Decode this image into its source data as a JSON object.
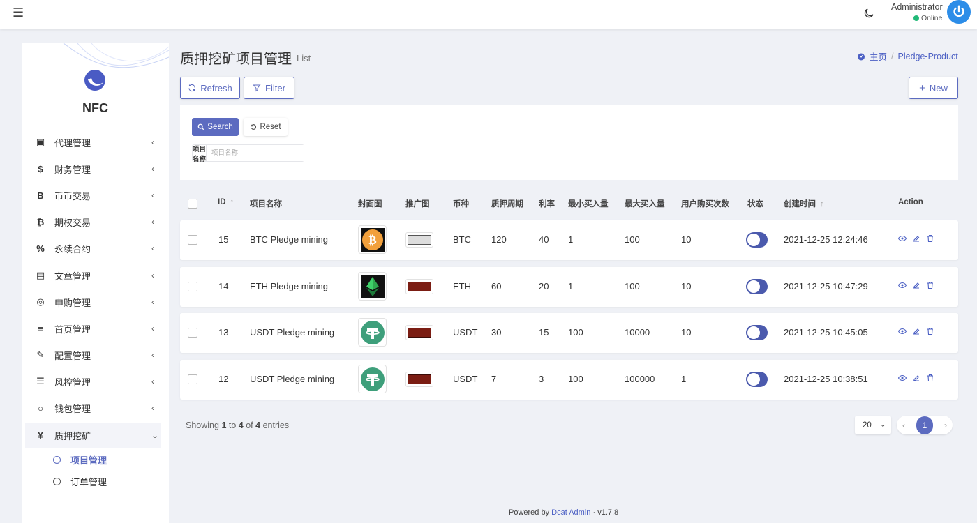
{
  "topbar": {
    "user_name": "Administrator",
    "user_status": "Online",
    "icons": [
      "hamburger-icon",
      "moon-icon",
      "power-avatar"
    ]
  },
  "sidebar": {
    "brand": "NFC",
    "items": [
      {
        "label": "代理管理",
        "icon": "id-card-icon",
        "glyph": "▣"
      },
      {
        "label": "财务管理",
        "icon": "dollar-icon",
        "glyph": "$"
      },
      {
        "label": "币币交易",
        "icon": "b-icon",
        "glyph": "B"
      },
      {
        "label": "期权交易",
        "icon": "bitcoin-icon",
        "glyph": "₿"
      },
      {
        "label": "永续合约",
        "icon": "link-icon",
        "glyph": "%"
      },
      {
        "label": "文章管理",
        "icon": "newspaper-icon",
        "glyph": "▤"
      },
      {
        "label": "申购管理",
        "icon": "lifebuoy-icon",
        "glyph": "◎"
      },
      {
        "label": "首页管理",
        "icon": "list-icon",
        "glyph": "≡"
      },
      {
        "label": "配置管理",
        "icon": "wrench-icon",
        "glyph": "✎"
      },
      {
        "label": "风控管理",
        "icon": "indent-icon",
        "glyph": "☰"
      },
      {
        "label": "钱包管理",
        "icon": "circle-icon",
        "glyph": "○"
      },
      {
        "label": "质押挖矿",
        "icon": "yen-icon",
        "glyph": "¥"
      }
    ],
    "submenu": [
      {
        "label": "项目管理"
      },
      {
        "label": "订单管理"
      }
    ]
  },
  "header": {
    "title": "质押挖矿项目管理",
    "subtitle": "List",
    "breadcrumb_home": "主页",
    "breadcrumb_current": "Pledge-Product"
  },
  "toolbar": {
    "refresh": "Refresh",
    "filter": "Filter",
    "new": "New"
  },
  "filter": {
    "search": "Search",
    "reset": "Reset",
    "field_label": "项目名称",
    "field_placeholder": "项目名称"
  },
  "table": {
    "columns": [
      "ID",
      "项目名称",
      "封面图",
      "推广图",
      "币种",
      "质押周期",
      "利率",
      "最小买入量",
      "最大买入量",
      "用户购买次数",
      "状态",
      "创建时间",
      "Action"
    ],
    "rows": [
      {
        "id": "15",
        "name": "BTC Pledge mining",
        "coin": "BTC",
        "period": "120",
        "rate": "40",
        "min": "1",
        "max": "100",
        "times": "10",
        "created": "2021-12-25 12:24:46",
        "cover": "bitcoin-logo",
        "banner": "light"
      },
      {
        "id": "14",
        "name": "ETH Pledge mining",
        "coin": "ETH",
        "period": "60",
        "rate": "20",
        "min": "1",
        "max": "100",
        "times": "10",
        "created": "2021-12-25 10:47:29",
        "cover": "ethereum-logo",
        "banner": "dark"
      },
      {
        "id": "13",
        "name": "USDT Pledge mining",
        "coin": "USDT",
        "period": "30",
        "rate": "15",
        "min": "100",
        "max": "10000",
        "times": "10",
        "created": "2021-12-25 10:45:05",
        "cover": "tether-logo",
        "banner": "dark"
      },
      {
        "id": "12",
        "name": "USDT Pledge mining",
        "coin": "USDT",
        "period": "7",
        "rate": "3",
        "min": "100",
        "max": "100000",
        "times": "1",
        "created": "2021-12-25 10:38:51",
        "cover": "tether-logo",
        "banner": "dark"
      }
    ]
  },
  "pagination": {
    "showing_prefix": "Showing",
    "from": "1",
    "to_word": "to",
    "to": "4",
    "of_word": "of",
    "total": "4",
    "entries_word": "entries",
    "page_size": "20",
    "current_page": "1"
  },
  "footer": {
    "powered_by": "Powered by",
    "brand": "Dcat Admin",
    "sep": "·",
    "version": "v1.7.8"
  },
  "colors": {
    "primary": "#5c6bc0",
    "toggle": "#4b5aad",
    "background": "#eff1f6",
    "online": "#21b978"
  }
}
